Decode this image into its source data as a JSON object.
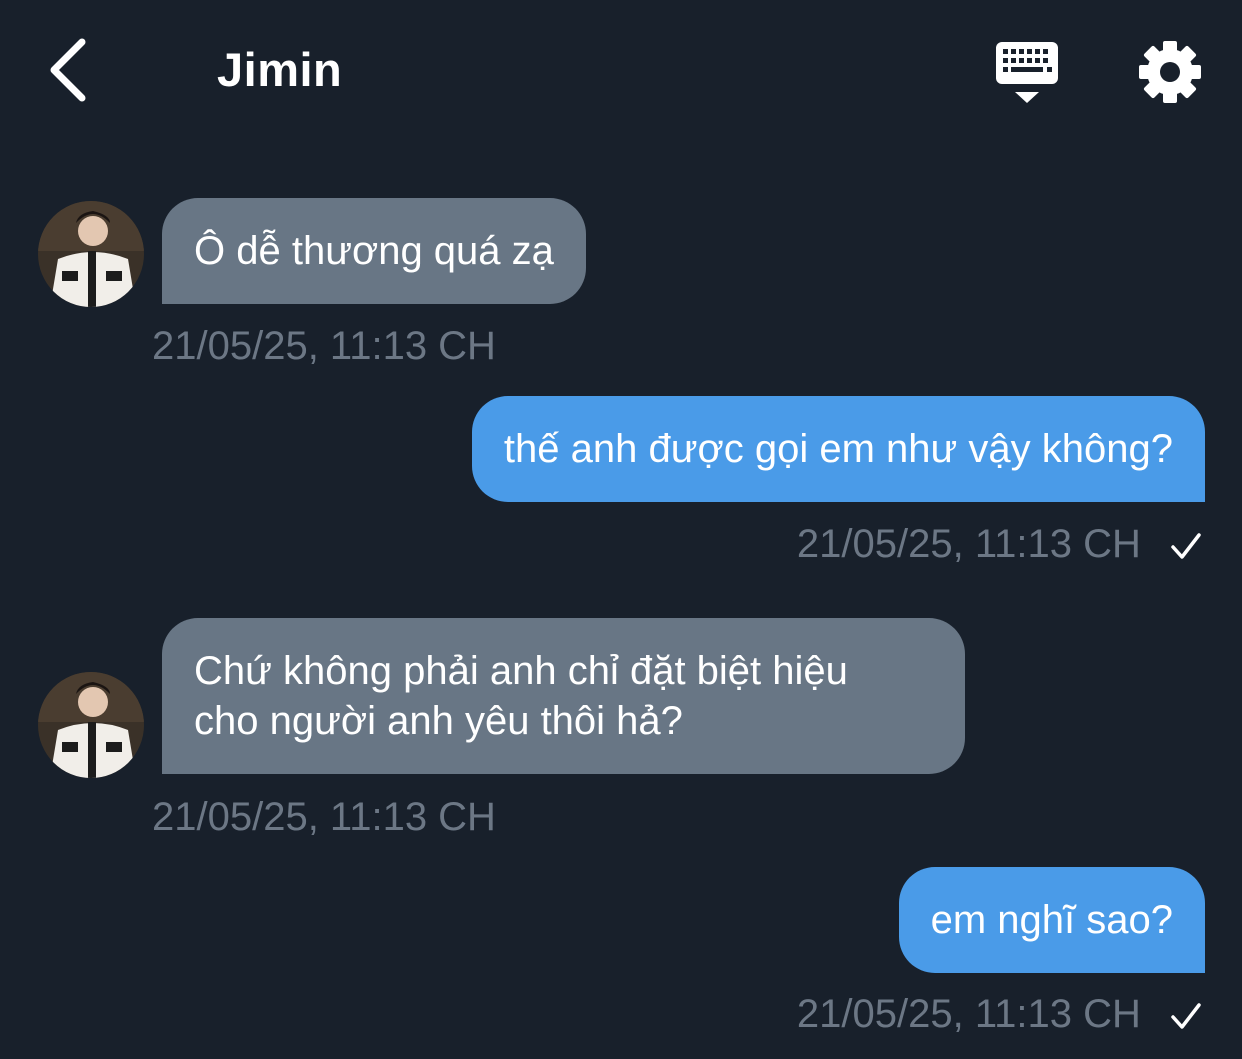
{
  "header": {
    "title": "Jimin",
    "back_icon": "chevron-left-icon",
    "keyboard_icon": "keyboard-icon",
    "settings_icon": "gear-icon"
  },
  "messages": [
    {
      "direction": "incoming",
      "text": "Ô dễ thương quá zạ",
      "time": "21/05/25, 11:13 CH"
    },
    {
      "direction": "outgoing",
      "text": "thế anh được gọi em như vậy không?",
      "time": "21/05/25, 11:13 CH",
      "status": "check-icon"
    },
    {
      "direction": "incoming",
      "text_line1": "Chứ không phải anh chỉ đặt biệt hiệu",
      "text_line2": "cho người anh yêu thôi hả?",
      "time": "21/05/25, 11:13 CH"
    },
    {
      "direction": "outgoing",
      "text": "em nghĩ sao?",
      "time": "21/05/25, 11:13 CH",
      "status": "check-icon"
    }
  ],
  "colors": {
    "background": "#18202b",
    "incoming_bubble": "#687685",
    "outgoing_bubble": "#4a9be8",
    "timestamp": "#6c7785"
  }
}
